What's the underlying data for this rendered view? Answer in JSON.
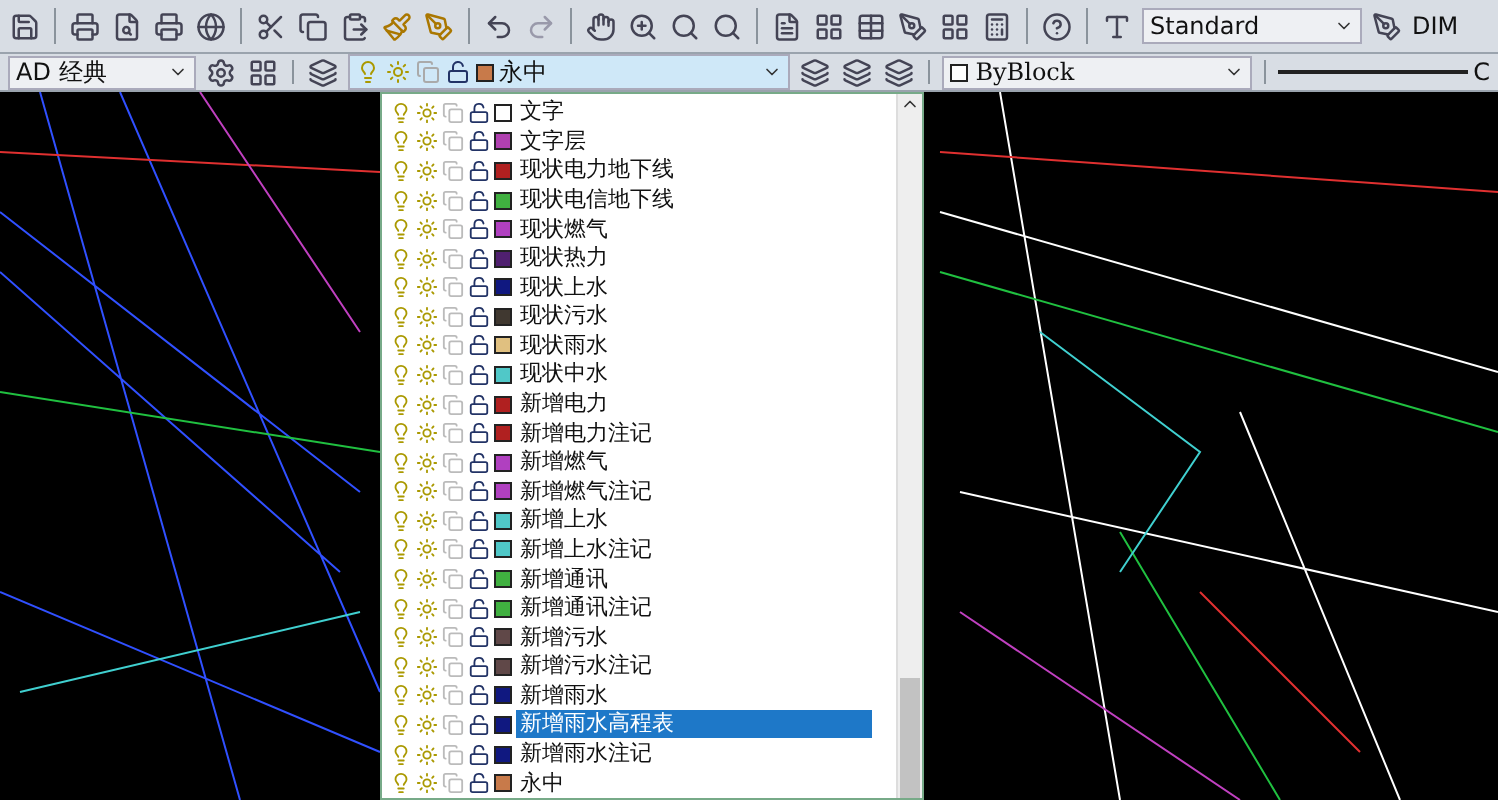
{
  "toolbar": {
    "text_style": "Standard",
    "dim_style": "DIM"
  },
  "workspace": {
    "value": "AD 经典"
  },
  "layer_combo": {
    "value": "永中",
    "color": "#c87a4a"
  },
  "color_combo": {
    "value": "ByBlock"
  },
  "linetype_label": "C",
  "layers": [
    {
      "name": "文字",
      "color": "#ffffff",
      "selected": false
    },
    {
      "name": "文字层",
      "color": "#b040b0",
      "selected": false
    },
    {
      "name": "现状电力地下线",
      "color": "#b02020",
      "selected": false
    },
    {
      "name": "现状电信地下线",
      "color": "#40b040",
      "selected": false
    },
    {
      "name": "现状燃气",
      "color": "#b040c0",
      "selected": false
    },
    {
      "name": "现状热力",
      "color": "#502070",
      "selected": false
    },
    {
      "name": "现状上水",
      "color": "#101880",
      "selected": false
    },
    {
      "name": "现状污水",
      "color": "#403830",
      "selected": false
    },
    {
      "name": "现状雨水",
      "color": "#e0c080",
      "selected": false
    },
    {
      "name": "现状中水",
      "color": "#50c8c8",
      "selected": false
    },
    {
      "name": "新增电力",
      "color": "#b02020",
      "selected": false
    },
    {
      "name": "新增电力注记",
      "color": "#b02020",
      "selected": false
    },
    {
      "name": "新增燃气",
      "color": "#b040c0",
      "selected": false
    },
    {
      "name": "新增燃气注记",
      "color": "#b040c0",
      "selected": false
    },
    {
      "name": "新增上水",
      "color": "#50c8c8",
      "selected": false
    },
    {
      "name": "新增上水注记",
      "color": "#50c8c8",
      "selected": false
    },
    {
      "name": "新增通讯",
      "color": "#40b040",
      "selected": false
    },
    {
      "name": "新增通讯注记",
      "color": "#40b040",
      "selected": false
    },
    {
      "name": "新增污水",
      "color": "#604848",
      "selected": false
    },
    {
      "name": "新增污水注记",
      "color": "#604848",
      "selected": false
    },
    {
      "name": "新增雨水",
      "color": "#101880",
      "selected": false
    },
    {
      "name": "新增雨水高程表",
      "color": "#101880",
      "selected": true
    },
    {
      "name": "新增雨水注记",
      "color": "#101880",
      "selected": false
    },
    {
      "name": "永中",
      "color": "#c87a4a",
      "selected": false
    }
  ]
}
